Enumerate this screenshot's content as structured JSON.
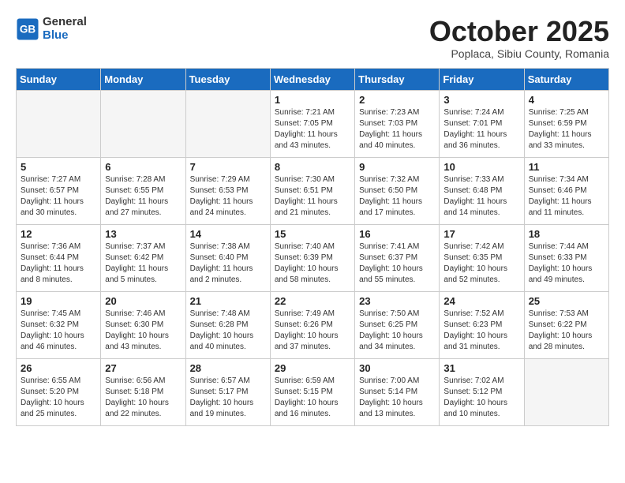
{
  "header": {
    "logo_general": "General",
    "logo_blue": "Blue",
    "month_title": "October 2025",
    "subtitle": "Poplaca, Sibiu County, Romania"
  },
  "weekdays": [
    "Sunday",
    "Monday",
    "Tuesday",
    "Wednesday",
    "Thursday",
    "Friday",
    "Saturday"
  ],
  "weeks": [
    [
      {
        "day": "",
        "info": ""
      },
      {
        "day": "",
        "info": ""
      },
      {
        "day": "",
        "info": ""
      },
      {
        "day": "1",
        "info": "Sunrise: 7:21 AM\nSunset: 7:05 PM\nDaylight: 11 hours\nand 43 minutes."
      },
      {
        "day": "2",
        "info": "Sunrise: 7:23 AM\nSunset: 7:03 PM\nDaylight: 11 hours\nand 40 minutes."
      },
      {
        "day": "3",
        "info": "Sunrise: 7:24 AM\nSunset: 7:01 PM\nDaylight: 11 hours\nand 36 minutes."
      },
      {
        "day": "4",
        "info": "Sunrise: 7:25 AM\nSunset: 6:59 PM\nDaylight: 11 hours\nand 33 minutes."
      }
    ],
    [
      {
        "day": "5",
        "info": "Sunrise: 7:27 AM\nSunset: 6:57 PM\nDaylight: 11 hours\nand 30 minutes."
      },
      {
        "day": "6",
        "info": "Sunrise: 7:28 AM\nSunset: 6:55 PM\nDaylight: 11 hours\nand 27 minutes."
      },
      {
        "day": "7",
        "info": "Sunrise: 7:29 AM\nSunset: 6:53 PM\nDaylight: 11 hours\nand 24 minutes."
      },
      {
        "day": "8",
        "info": "Sunrise: 7:30 AM\nSunset: 6:51 PM\nDaylight: 11 hours\nand 21 minutes."
      },
      {
        "day": "9",
        "info": "Sunrise: 7:32 AM\nSunset: 6:50 PM\nDaylight: 11 hours\nand 17 minutes."
      },
      {
        "day": "10",
        "info": "Sunrise: 7:33 AM\nSunset: 6:48 PM\nDaylight: 11 hours\nand 14 minutes."
      },
      {
        "day": "11",
        "info": "Sunrise: 7:34 AM\nSunset: 6:46 PM\nDaylight: 11 hours\nand 11 minutes."
      }
    ],
    [
      {
        "day": "12",
        "info": "Sunrise: 7:36 AM\nSunset: 6:44 PM\nDaylight: 11 hours\nand 8 minutes."
      },
      {
        "day": "13",
        "info": "Sunrise: 7:37 AM\nSunset: 6:42 PM\nDaylight: 11 hours\nand 5 minutes."
      },
      {
        "day": "14",
        "info": "Sunrise: 7:38 AM\nSunset: 6:40 PM\nDaylight: 11 hours\nand 2 minutes."
      },
      {
        "day": "15",
        "info": "Sunrise: 7:40 AM\nSunset: 6:39 PM\nDaylight: 10 hours\nand 58 minutes."
      },
      {
        "day": "16",
        "info": "Sunrise: 7:41 AM\nSunset: 6:37 PM\nDaylight: 10 hours\nand 55 minutes."
      },
      {
        "day": "17",
        "info": "Sunrise: 7:42 AM\nSunset: 6:35 PM\nDaylight: 10 hours\nand 52 minutes."
      },
      {
        "day": "18",
        "info": "Sunrise: 7:44 AM\nSunset: 6:33 PM\nDaylight: 10 hours\nand 49 minutes."
      }
    ],
    [
      {
        "day": "19",
        "info": "Sunrise: 7:45 AM\nSunset: 6:32 PM\nDaylight: 10 hours\nand 46 minutes."
      },
      {
        "day": "20",
        "info": "Sunrise: 7:46 AM\nSunset: 6:30 PM\nDaylight: 10 hours\nand 43 minutes."
      },
      {
        "day": "21",
        "info": "Sunrise: 7:48 AM\nSunset: 6:28 PM\nDaylight: 10 hours\nand 40 minutes."
      },
      {
        "day": "22",
        "info": "Sunrise: 7:49 AM\nSunset: 6:26 PM\nDaylight: 10 hours\nand 37 minutes."
      },
      {
        "day": "23",
        "info": "Sunrise: 7:50 AM\nSunset: 6:25 PM\nDaylight: 10 hours\nand 34 minutes."
      },
      {
        "day": "24",
        "info": "Sunrise: 7:52 AM\nSunset: 6:23 PM\nDaylight: 10 hours\nand 31 minutes."
      },
      {
        "day": "25",
        "info": "Sunrise: 7:53 AM\nSunset: 6:22 PM\nDaylight: 10 hours\nand 28 minutes."
      }
    ],
    [
      {
        "day": "26",
        "info": "Sunrise: 6:55 AM\nSunset: 5:20 PM\nDaylight: 10 hours\nand 25 minutes."
      },
      {
        "day": "27",
        "info": "Sunrise: 6:56 AM\nSunset: 5:18 PM\nDaylight: 10 hours\nand 22 minutes."
      },
      {
        "day": "28",
        "info": "Sunrise: 6:57 AM\nSunset: 5:17 PM\nDaylight: 10 hours\nand 19 minutes."
      },
      {
        "day": "29",
        "info": "Sunrise: 6:59 AM\nSunset: 5:15 PM\nDaylight: 10 hours\nand 16 minutes."
      },
      {
        "day": "30",
        "info": "Sunrise: 7:00 AM\nSunset: 5:14 PM\nDaylight: 10 hours\nand 13 minutes."
      },
      {
        "day": "31",
        "info": "Sunrise: 7:02 AM\nSunset: 5:12 PM\nDaylight: 10 hours\nand 10 minutes."
      },
      {
        "day": "",
        "info": ""
      }
    ]
  ]
}
